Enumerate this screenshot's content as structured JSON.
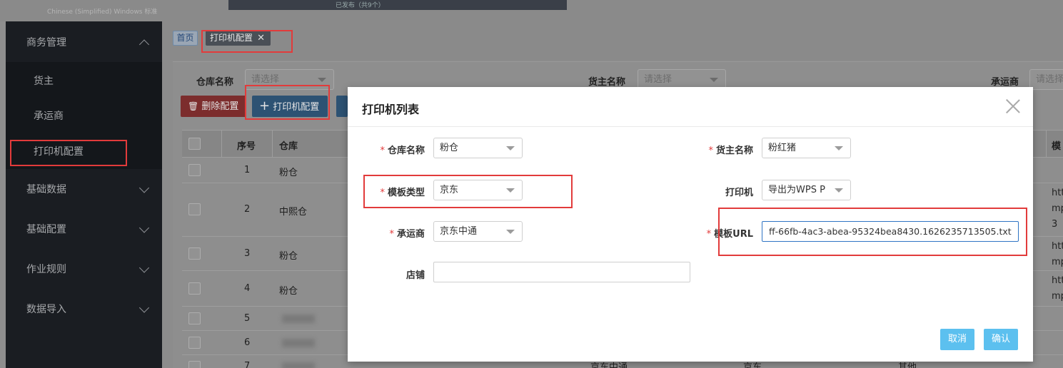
{
  "topstrip": {
    "faint_text": "Chinese (Simplified) Windows 标准",
    "faint_text2": "已发布（共9个）"
  },
  "sidebar": {
    "business_mgmt": "商务管理",
    "sub_items": [
      "货主",
      "承运商",
      "打印机配置"
    ],
    "items": [
      "基础数据",
      "基础配置",
      "作业规则",
      "数据导入"
    ]
  },
  "tabs": {
    "home": "首页",
    "active": "打印机配置",
    "close": "✕"
  },
  "filters": {
    "warehouse_label": "仓库名称",
    "warehouse_placeholder": "请选择",
    "owner_label": "货主名称",
    "owner_placeholder": "请选择",
    "carrier_label": "承运商",
    "carrier_placeholder": "请选择"
  },
  "toolbar": {
    "delete_label": "删除配置",
    "print_config_label": "打印机配置",
    "trash_icon": "🗑",
    "plus_icon": "+"
  },
  "table": {
    "headers": {
      "index": "序号",
      "warehouse": "仓库"
    },
    "rows": [
      {
        "index": "1",
        "warehouse": "粉仓"
      },
      {
        "index": "2",
        "warehouse": "中熙仓"
      },
      {
        "index": "3",
        "warehouse": "粉仓"
      },
      {
        "index": "4",
        "warehouse": "粉仓"
      },
      {
        "index": "5",
        "warehouse": ""
      },
      {
        "index": "6",
        "warehouse": ""
      },
      {
        "index": "7",
        "warehouse": ""
      }
    ],
    "bottom_row_cells": [
      "京东中通",
      "京东",
      "其他"
    ],
    "right_peek": {
      "header": "模",
      "row2": [
        "htt",
        "mp",
        "3"
      ],
      "row3": [
        "htt",
        "mp"
      ],
      "row4": [
        "htt",
        "mp"
      ]
    }
  },
  "modal": {
    "title": "打印机列表",
    "fields": {
      "warehouse": {
        "label": "仓库名称",
        "value": "粉仓",
        "required": "*"
      },
      "owner": {
        "label": "货主名称",
        "value": "粉红猪",
        "required": "*"
      },
      "template_type": {
        "label": "模板类型",
        "value": "京东",
        "required": "*"
      },
      "printer": {
        "label": "打印机",
        "value": "导出为WPS P"
      },
      "carrier": {
        "label": "承运商",
        "value": "京东中通",
        "required": "*"
      },
      "template_url": {
        "label": "模板URL",
        "value": "ff-66fb-4ac3-abea-95324bea8430.1626235713505.txt",
        "required": "*"
      },
      "shop": {
        "label": "店铺",
        "value": ""
      }
    },
    "cancel_label": "取消",
    "confirm_label": "确认"
  },
  "colors": {
    "highlight_red": "#e23b3b",
    "modal_button": "#5cc0ef",
    "sidebar_bg": "#1a1d22"
  }
}
